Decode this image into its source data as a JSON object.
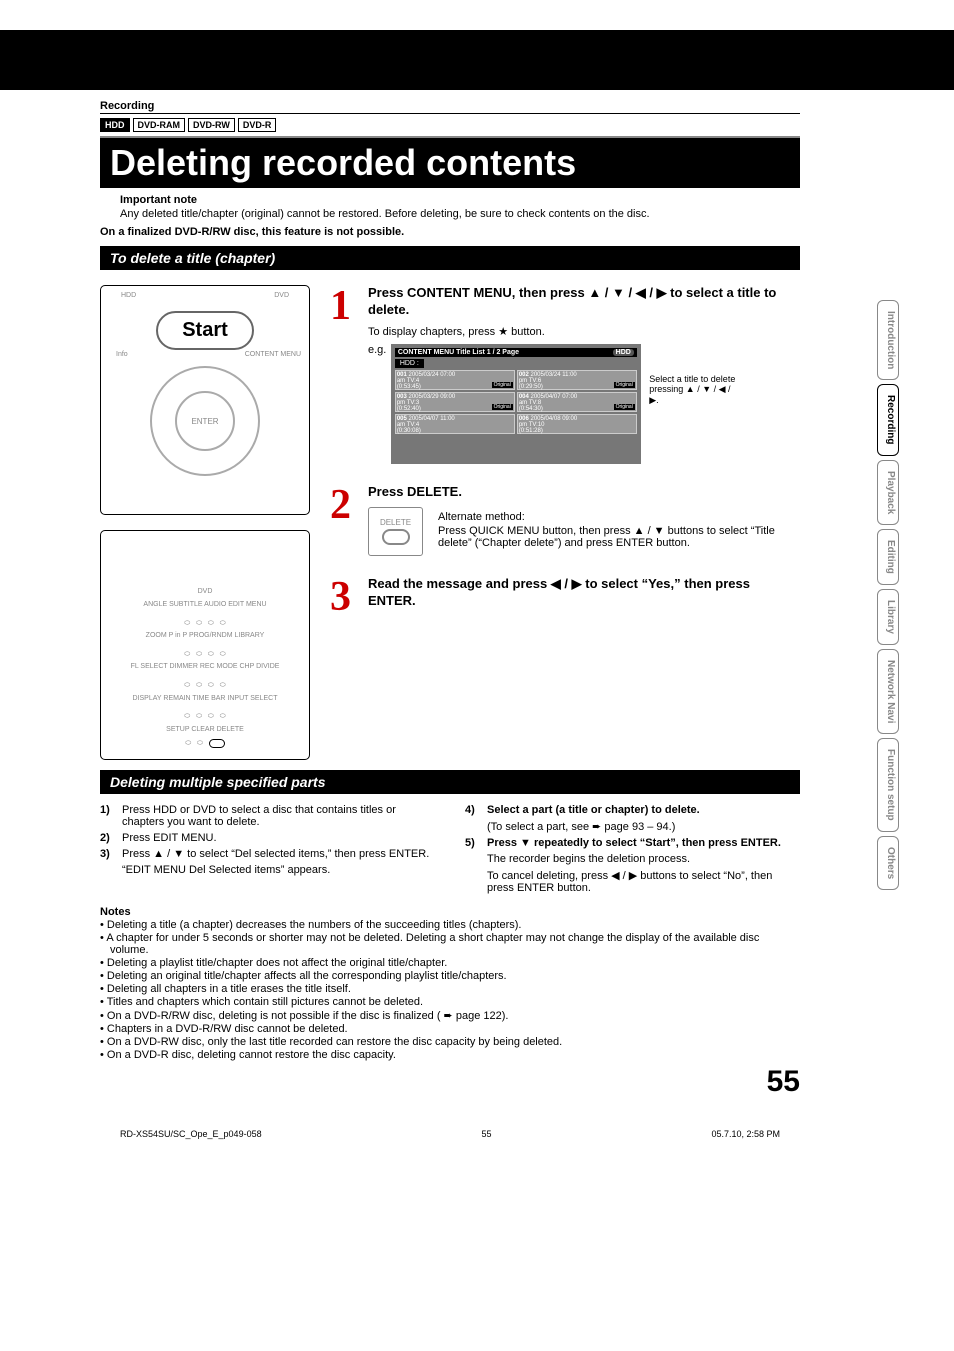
{
  "section_label": "Recording",
  "badges": {
    "hdd": "HDD",
    "ram": "DVD-RAM",
    "rw": "DVD-RW",
    "r": "DVD-R"
  },
  "page_title": "Deleting recorded contents",
  "important_label": "Important note",
  "important_text": "Any deleted title/chapter (original) cannot be restored. Before deleting, be sure to check contents on the disc.",
  "finalized_note": "On a finalized DVD-R/RW disc, this feature is not possible.",
  "heading1": "To delete a title (chapter)",
  "start_label": "Start",
  "remote": {
    "row1": "ANGLE   SUBTITLE   AUDIO   EDIT MENU",
    "row2": "ZOOM    P in P    PROG/RNDM  LIBRARY",
    "row3": "FL SELECT  DIMMER  REC MODE  CHP DIVIDE",
    "row4": "DISPLAY  REMAIN  TIME BAR  INPUT SELECT",
    "row5": "SETUP   CLEAR   DELETE",
    "dvd": "DVD"
  },
  "step1": {
    "head": "Press CONTENT MENU, then press ▲ / ▼ / ◀ / ▶ to select a title to delete.",
    "text": "To display chapters, press ★ button.",
    "eg": "e.g.",
    "annot": "Select a title to delete pressing ▲ / ▼ / ◀ / ▶.",
    "tl_header": "CONTENT MENU   Title List          1 / 2  Page",
    "tl_hdd": "HDD :",
    "hdd_icon": "HDD",
    "cells": [
      {
        "id": "001",
        "date": "2005/03/24 07:00",
        "ch": "am  TV:4",
        "dur": "(0:53:45)",
        "tag": "Original"
      },
      {
        "id": "002",
        "date": "2005/03/24 11:00",
        "ch": "pm  TV:6",
        "dur": "(0:29:50)",
        "tag": "Original"
      },
      {
        "id": "003",
        "date": "2005/03/29 09:00",
        "ch": "pm  TV:3",
        "dur": "(0:52:40)",
        "tag": "Original"
      },
      {
        "id": "004",
        "date": "2005/04/07 07:00",
        "ch": "am  TV:8",
        "dur": "(0:54:30)",
        "tag": "Original"
      },
      {
        "id": "005",
        "date": "2005/04/07 11:00",
        "ch": "am  TV:4",
        "dur": "(0:30:08)",
        "tag": ""
      },
      {
        "id": "006",
        "date": "2005/04/08 09:00",
        "ch": "pm  TV:10",
        "dur": "(0:51:28)",
        "tag": ""
      }
    ]
  },
  "step2": {
    "head": "Press DELETE.",
    "btn_label": "DELETE",
    "alt_head": "Alternate method:",
    "alt_text": "Press QUICK MENU button, then press ▲ / ▼ buttons to select “Title delete” (“Chapter delete”) and press ENTER button."
  },
  "step3": {
    "head": "Read the message and press ◀ / ▶ to select “Yes,” then press ENTER."
  },
  "heading2": "Deleting multiple specified parts",
  "left_steps": [
    {
      "n": "1)",
      "b": "Press HDD or DVD to select a disc that contains titles or chapters you want to delete."
    },
    {
      "n": "2)",
      "b": "Press EDIT MENU."
    },
    {
      "n": "3)",
      "b": "Press ▲ / ▼ to select “Del selected items,” then press ENTER."
    }
  ],
  "left_sub": "“EDIT MENU Del Selected items” appears.",
  "right_steps": [
    {
      "n": "4)",
      "b": "Select a part (a title or chapter) to delete.",
      "sub": "(To select a part, see ➨ page 93 – 94.)"
    },
    {
      "n": "5)",
      "b": "Press ▼ repeatedly to select “Start”, then press ENTER.",
      "sub": "The recorder begins the deletion process.",
      "sub2": "To cancel deleting, press ◀ / ▶ buttons to select “No”, then press ENTER button."
    }
  ],
  "notes_label": "Notes",
  "notes": [
    "Deleting a title (a chapter) decreases the numbers of the succeeding titles (chapters).",
    "A chapter for under 5 seconds or shorter may not be deleted. Deleting a short chapter may not change the display of the available disc volume.",
    "Deleting a playlist title/chapter does not affect the original title/chapter.",
    "Deleting an original title/chapter affects all the corresponding playlist title/chapters.",
    "Deleting all chapters in a title erases the title itself.",
    "Titles and chapters which contain still pictures cannot be deleted.",
    "On a DVD-R/RW disc, deleting is not possible if the disc is finalized ( ➨ page 122).",
    "Chapters in a DVD-R/RW disc cannot be deleted.",
    "On a DVD-RW disc, only the last title recorded can restore the disc capacity by being deleted.",
    "On a DVD-R disc, deleting cannot restore the disc capacity."
  ],
  "page_number": "55",
  "side_tabs": [
    "Introduction",
    "Recording",
    "Playback",
    "Editing",
    "Library",
    "Network Navi",
    "Function setup",
    "Others"
  ],
  "active_tab_index": 1,
  "footer": {
    "left": "RD-XS54SU/SC_Ope_E_p049-058",
    "mid": "55",
    "right": "05.7.10, 2:58 PM"
  },
  "remote_labels": {
    "info": "Info",
    "content_menu": "CONTENT MENU",
    "enter": "ENTER",
    "hdd": "HDD",
    "dvd": "DVD"
  }
}
